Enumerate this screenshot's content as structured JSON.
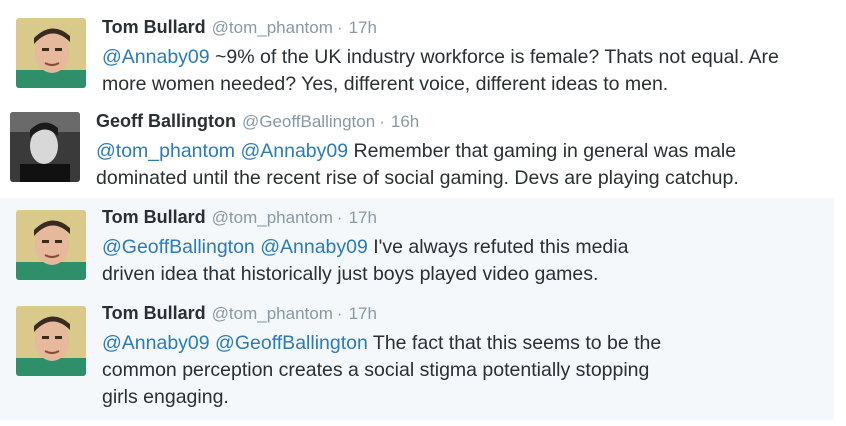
{
  "colors": {
    "link": "#2b7bb9",
    "meta": "#8899a6",
    "text": "#292f33",
    "highlight_bg": "#f5f8fa"
  },
  "tweets": [
    {
      "name": "Tom Bullard",
      "handle": "@tom_phantom",
      "sep": "·",
      "time": "17h",
      "lines": [
        [
          {
            "t": "@Annaby09",
            "m": true
          },
          {
            "t": " ~9% of the UK industry workforce is female? Thats not equal. Are",
            "m": false
          }
        ],
        [
          {
            "t": "more women needed? Yes, different voice, different ideas to men.",
            "m": false
          }
        ]
      ]
    },
    {
      "name": "Geoff Ballington",
      "handle": "@GeoffBallington",
      "sep": "·",
      "time": "16h",
      "lines": [
        [
          {
            "t": "@tom_phantom",
            "m": true
          },
          {
            "t": " ",
            "m": false
          },
          {
            "t": "@Annaby09",
            "m": true
          },
          {
            "t": " Remember that gaming in general was male",
            "m": false
          }
        ],
        [
          {
            "t": "dominated until the recent rise of social gaming. Devs are playing catchup.",
            "m": false
          }
        ]
      ]
    },
    {
      "name": "Tom Bullard",
      "handle": "@tom_phantom",
      "sep": "·",
      "time": "17h",
      "lines": [
        [
          {
            "t": "@GeoffBallington",
            "m": true
          },
          {
            "t": " ",
            "m": false
          },
          {
            "t": "@Annaby09",
            "m": true
          },
          {
            "t": " I've always refuted this media",
            "m": false
          }
        ],
        [
          {
            "t": "driven idea that historically just boys played video games.",
            "m": false
          }
        ]
      ]
    },
    {
      "name": "Tom Bullard",
      "handle": "@tom_phantom",
      "sep": "·",
      "time": "17h",
      "lines": [
        [
          {
            "t": "@Annaby09",
            "m": true
          },
          {
            "t": " ",
            "m": false
          },
          {
            "t": "@GeoffBallington",
            "m": true
          },
          {
            "t": " The fact that this seems to be the",
            "m": false
          }
        ],
        [
          {
            "t": "common perception creates a social stigma potentially stopping",
            "m": false
          }
        ],
        [
          {
            "t": "girls engaging.",
            "m": false
          }
        ]
      ]
    }
  ]
}
